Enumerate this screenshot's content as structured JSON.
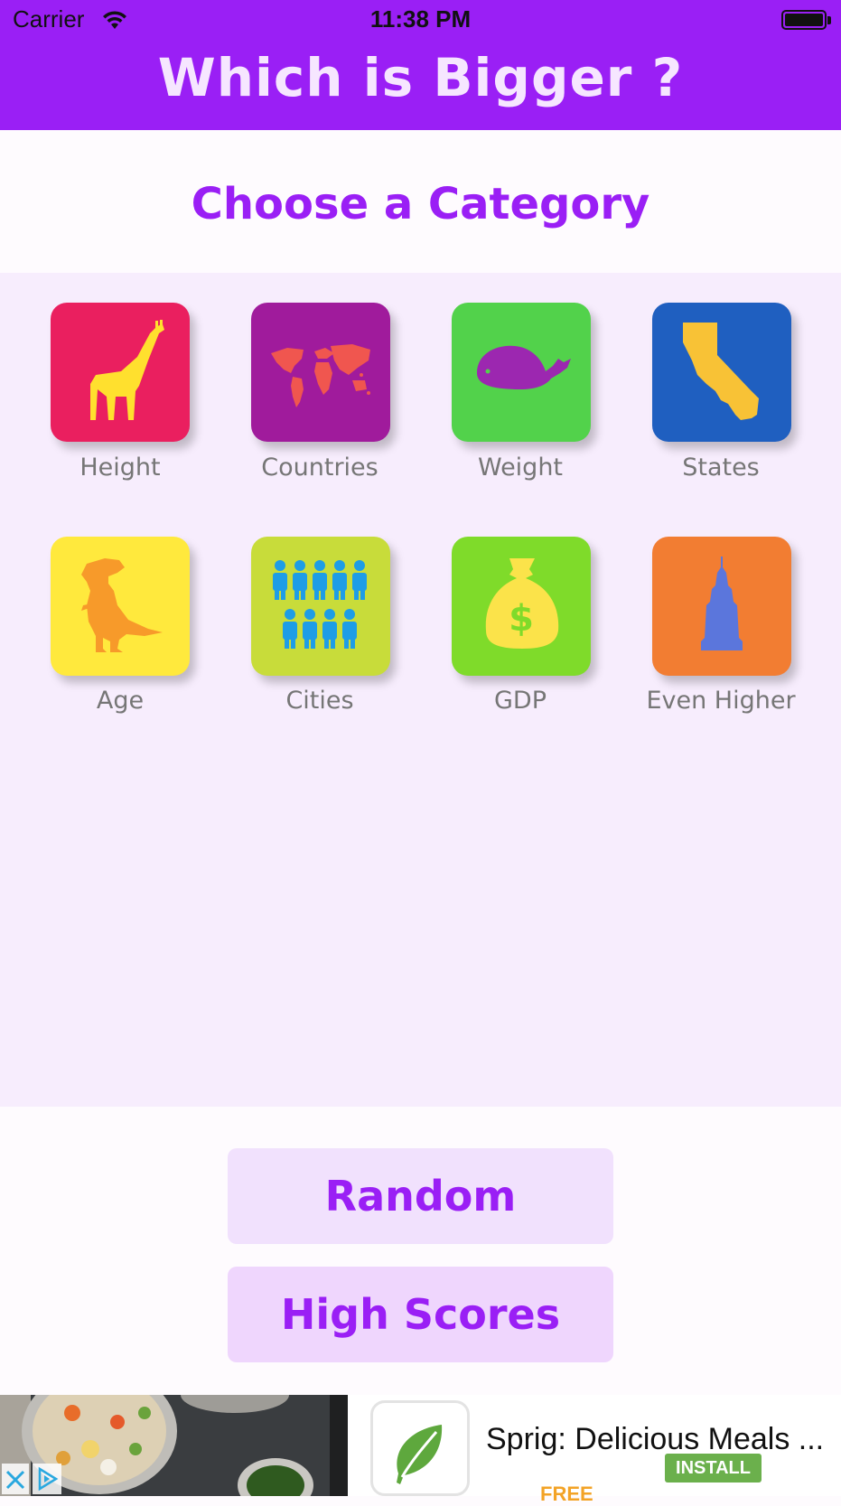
{
  "status_bar": {
    "carrier": "Carrier",
    "time": "11:38 PM"
  },
  "header": {
    "title": "Which is Bigger ?"
  },
  "category_section": {
    "title": "Choose a Category"
  },
  "categories": [
    {
      "label": "Height",
      "color": "#ea1f5f",
      "icon": "giraffe-icon"
    },
    {
      "label": "Countries",
      "color": "#a01b9c",
      "icon": "world-map-icon"
    },
    {
      "label": "Weight",
      "color": "#52d24b",
      "icon": "whale-icon"
    },
    {
      "label": "States",
      "color": "#1f5fc0",
      "icon": "california-icon"
    },
    {
      "label": "Age",
      "color": "#ffe93d",
      "icon": "dinosaur-icon"
    },
    {
      "label": "Cities",
      "color": "#c8dc3a",
      "icon": "people-crowd-icon"
    },
    {
      "label": "GDP",
      "color": "#7fdb2a",
      "icon": "money-bag-icon"
    },
    {
      "label": "Even Higher",
      "color": "#f27d32",
      "icon": "skyscraper-icon"
    }
  ],
  "buttons": {
    "random": "Random",
    "high_scores": "High Scores"
  },
  "ad": {
    "title": "Sprig: Delicious Meals ...",
    "price": "FREE",
    "install": "INSTALL"
  },
  "colors": {
    "accent": "#9a1ff5",
    "header_text": "#f6e6ff",
    "grid_background": "#f7edfd",
    "button_background": "#efdcfd",
    "label_text": "#767676"
  }
}
